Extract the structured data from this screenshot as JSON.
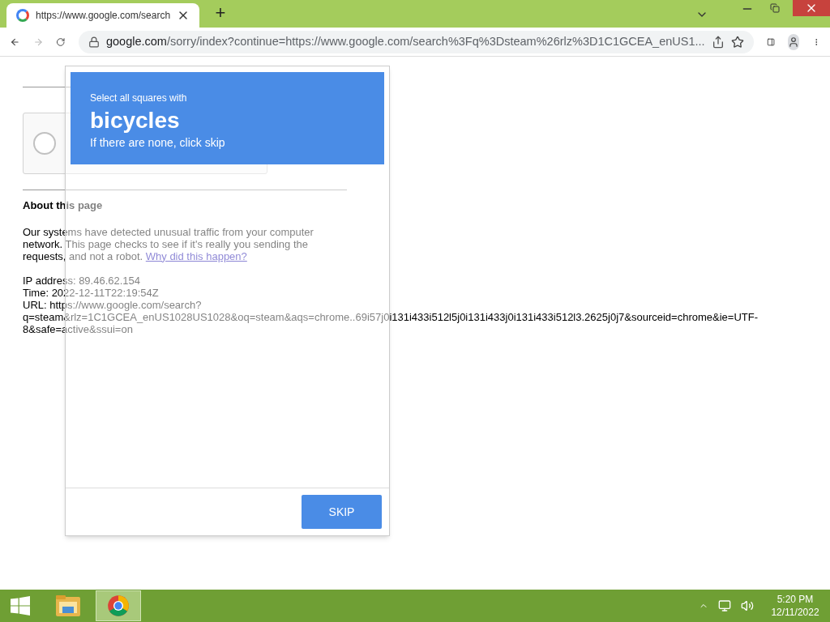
{
  "browser": {
    "tab": {
      "title": "https://www.google.com/search",
      "selected": true
    },
    "new_tab": "+",
    "address": {
      "host": "google.com",
      "path": "/sorry/index?continue=https://www.google.com/search%3Fq%3Dsteam%26rlz%3D1C1GCEA_enUS1..."
    }
  },
  "page": {
    "recaptcha": {
      "checked": false
    },
    "heading": "About this page",
    "paragraph": "Our systems have detected unusual traffic from your computer network. This page checks to see if it's really you sending the requests, and not a robot.",
    "link": "Why did this happen?",
    "info": [
      "IP address: 89.46.62.154",
      "Time: 2022-12-11T22:19:54Z",
      "URL: https://www.google.com/search?q=steam&rlz=1C1GCEA_enUS1028US1028&oq=steam&aqs=chrome..69i57j0i131i433i512l5j0i131i433j0i131i433i512l3.2625j0j7&sourceid=chrome&ie=UTF-8&safe=active&ssui=on"
    ]
  },
  "challenge": {
    "prompt": "Select all squares with",
    "target": "bicycles",
    "hint": "If there are none, click skip",
    "button": "SKIP"
  },
  "taskbar": {
    "apps": [
      {
        "kind": "folder",
        "selected": false
      },
      {
        "kind": "chrome",
        "selected": true
      }
    ],
    "time": "5:20 PM",
    "date": "12/11/2022"
  }
}
